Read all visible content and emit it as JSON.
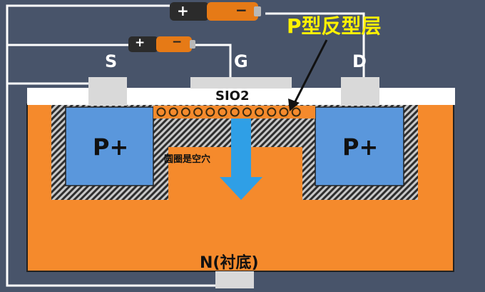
{
  "labels": {
    "source": "S",
    "gate": "G",
    "drain": "D",
    "oxide": "SIO2",
    "p_plus_left": "P+",
    "p_plus_right": "P+",
    "inversion_layer": "P型反型层",
    "holes_note": "圆圈是空穴",
    "substrate": "N(衬底)"
  },
  "batteries": [
    {
      "plus": "+",
      "minus": "−"
    },
    {
      "plus": "+",
      "minus": "−"
    }
  ],
  "colors": {
    "background": "#48546a",
    "substrate": "#f58a2c",
    "p_region": "#5a97dc",
    "oxide": "#ffffff",
    "contact": "#d9d9d9",
    "wire": "#ffffff",
    "inversion_label": "#fff200",
    "arrow": "#2f9fe6",
    "hatch": "#3a3a3a"
  },
  "hole_count": 12
}
